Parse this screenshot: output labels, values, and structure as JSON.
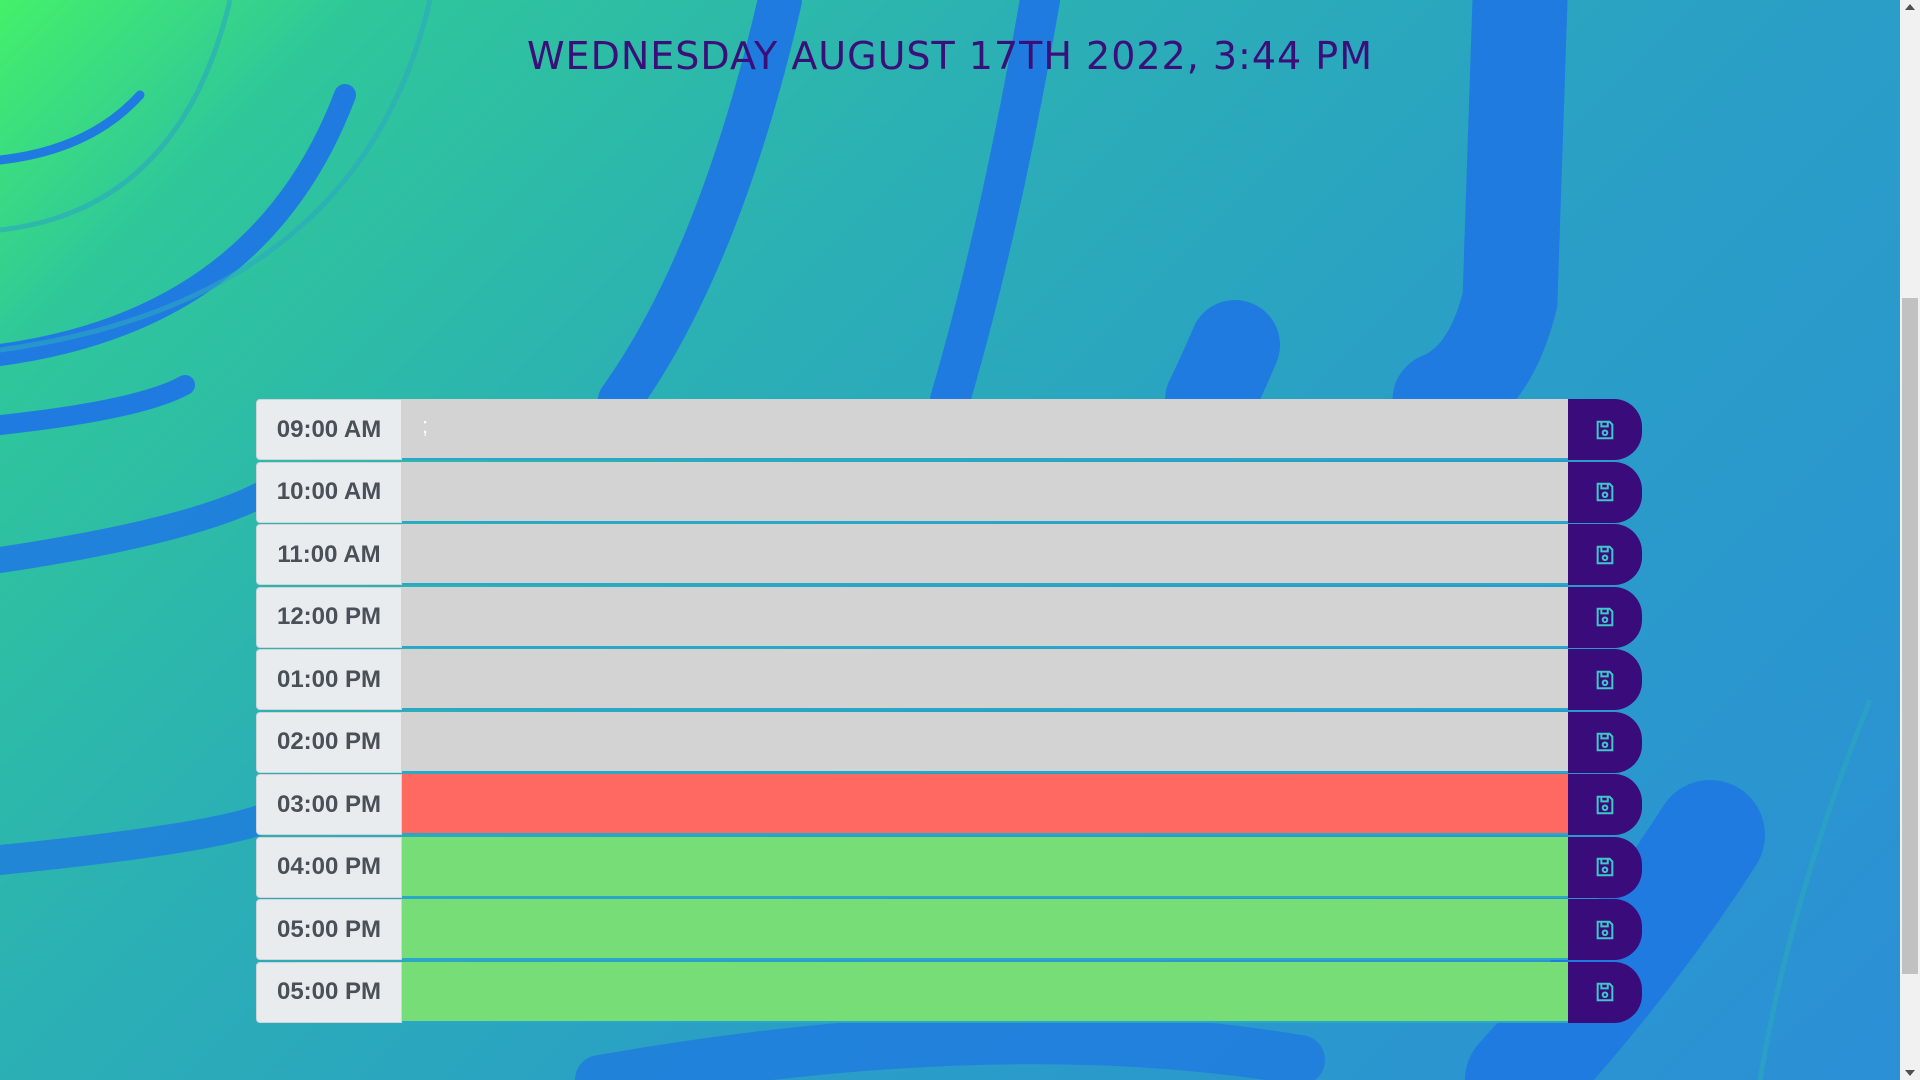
{
  "header": {
    "date_time": "WEDNESDAY AUGUST 17TH 2022, 3:44 PM"
  },
  "colors": {
    "past": "#d3d3d3",
    "present": "#ff6961",
    "future": "#77dd77",
    "save_button": "#3a0b7a",
    "title": "#3b0f7a"
  },
  "schedule": {
    "rows": [
      {
        "hour": "09:00 AM",
        "text": ";",
        "state": "past",
        "icon": "save-icon"
      },
      {
        "hour": "10:00 AM",
        "text": "",
        "state": "past",
        "icon": "save-icon"
      },
      {
        "hour": "11:00 AM",
        "text": "",
        "state": "past",
        "icon": "save-icon"
      },
      {
        "hour": "12:00 PM",
        "text": "",
        "state": "past",
        "icon": "save-icon"
      },
      {
        "hour": "01:00 PM",
        "text": "",
        "state": "past",
        "icon": "save-icon"
      },
      {
        "hour": "02:00 PM",
        "text": "",
        "state": "past",
        "icon": "save-icon"
      },
      {
        "hour": "03:00 PM",
        "text": "",
        "state": "present",
        "icon": "save-icon"
      },
      {
        "hour": "04:00 PM",
        "text": "",
        "state": "future",
        "icon": "save-icon"
      },
      {
        "hour": "05:00 PM",
        "text": "",
        "state": "future",
        "icon": "save-icon"
      },
      {
        "hour": "05:00 PM",
        "text": "",
        "state": "future",
        "icon": "save-icon"
      }
    ]
  }
}
